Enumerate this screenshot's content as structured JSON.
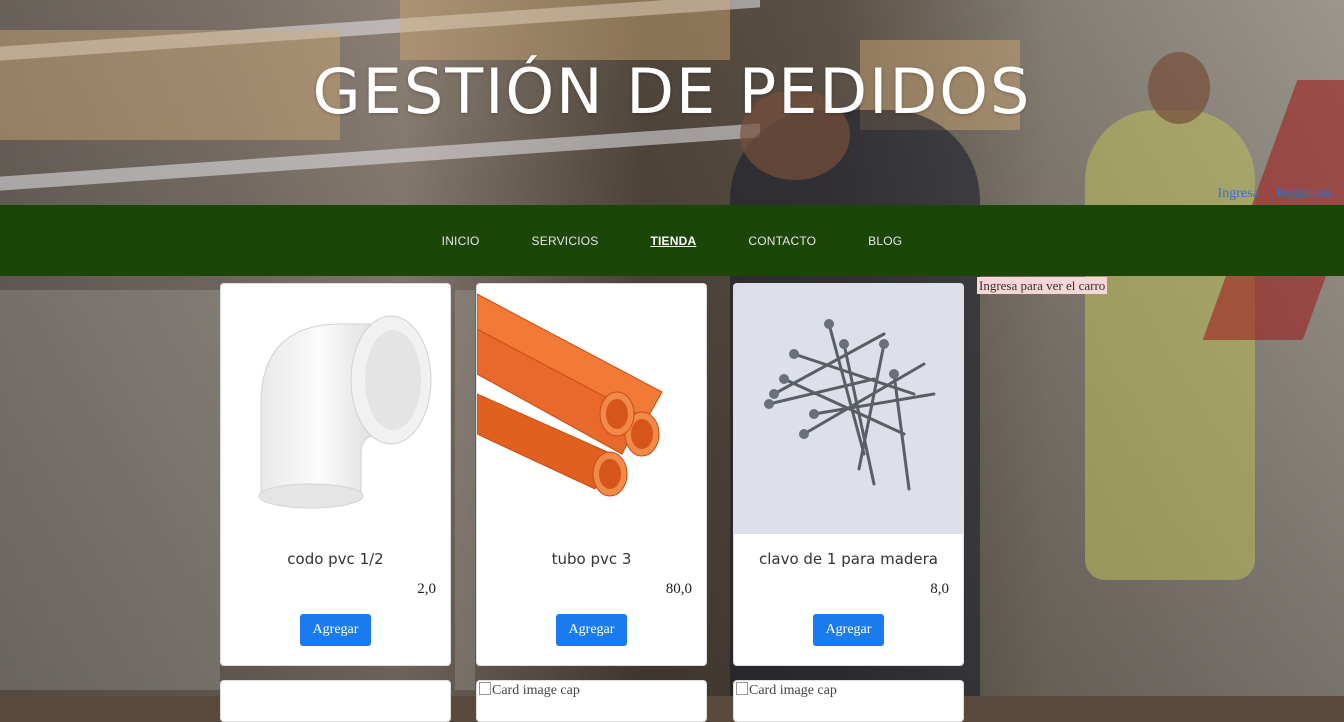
{
  "header": {
    "title": "GESTIÓN DE PEDIDOS",
    "login_label": "Ingresa",
    "register_label": "Registrate"
  },
  "nav": {
    "items": [
      {
        "label": "INICIO",
        "active": false
      },
      {
        "label": "SERVICIOS",
        "active": false
      },
      {
        "label": "TIENDA",
        "active": true
      },
      {
        "label": "CONTACTO",
        "active": false
      },
      {
        "label": "BLOG",
        "active": false
      }
    ]
  },
  "cart": {
    "notice": "Ingresa para ver el carro"
  },
  "products": [
    {
      "name": "codo pvc 1/2",
      "price": "2,0",
      "button": "Agregar",
      "image": "pvc-elbow-icon"
    },
    {
      "name": "tubo pvc 3",
      "price": "80,0",
      "button": "Agregar",
      "image": "orange-pipes-icon"
    },
    {
      "name": "clavo de 1 para madera",
      "price": "8,0",
      "button": "Agregar",
      "image": "nails-icon"
    }
  ],
  "next_row": {
    "alt_text": "Card image cap"
  },
  "colors": {
    "navbar_bg": "#1b4608",
    "button": "#1a7bef",
    "link": "#2f6fd8",
    "cart_notice_bg": "#f6d6d6"
  }
}
